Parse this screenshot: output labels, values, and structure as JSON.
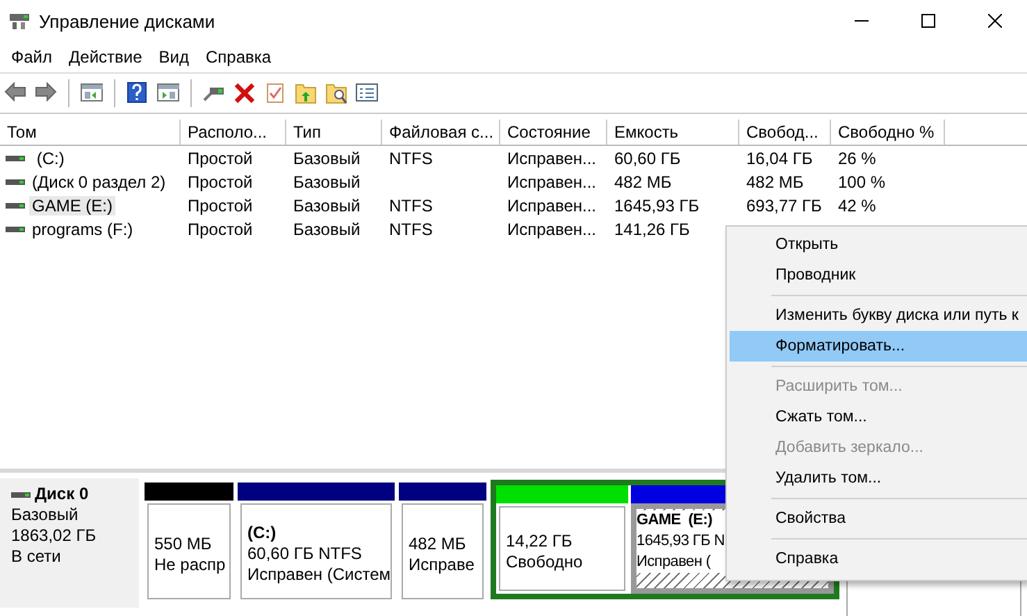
{
  "window": {
    "title": "Управление дисками"
  },
  "menu_bar": [
    "Файл",
    "Действие",
    "Вид",
    "Справка"
  ],
  "toolbar": [
    {
      "kind": "back"
    },
    {
      "kind": "forward"
    },
    {
      "kind": "separator"
    },
    {
      "kind": "tree"
    },
    {
      "kind": "separator"
    },
    {
      "kind": "help"
    },
    {
      "kind": "pane"
    },
    {
      "kind": "separator"
    },
    {
      "kind": "connect"
    },
    {
      "kind": "delete"
    },
    {
      "kind": "properties"
    },
    {
      "kind": "folder-up"
    },
    {
      "kind": "folder-search"
    },
    {
      "kind": "list"
    }
  ],
  "table": {
    "columns": [
      "Том",
      "Располо...",
      "Тип",
      "Файловая с...",
      "Состояние",
      "Емкость",
      "Свобод...",
      "Свободно %"
    ],
    "rows": [
      {
        "selected": false,
        "cells": [
          " (C:)",
          "Простой",
          "Базовый",
          "NTFS",
          "Исправен...",
          "60,60 ГБ",
          "16,04 ГБ",
          "26 %"
        ]
      },
      {
        "selected": false,
        "cells": [
          "(Диск 0 раздел 2)",
          "Простой",
          "Базовый",
          "",
          "Исправен...",
          "482 МБ",
          "482 МБ",
          "100 %"
        ]
      },
      {
        "selected": true,
        "cells": [
          "GAME (E:)",
          "Простой",
          "Базовый",
          "NTFS",
          "Исправен...",
          "1645,93 ГБ",
          "693,77 ГБ",
          "42 %"
        ]
      },
      {
        "selected": false,
        "cells": [
          "programs (F:)",
          "Простой",
          "Базовый",
          "NTFS",
          "Исправен...",
          "141,26 ГБ",
          "",
          ""
        ]
      }
    ]
  },
  "disk": {
    "name": "Диск 0",
    "type": "Базовый",
    "size": "1863,02 ГБ",
    "status": "В сети",
    "partitions": [
      {
        "kind": "unallocated",
        "selected": false,
        "lines": [
          "550 МБ",
          "Не распр"
        ]
      },
      {
        "kind": "primary",
        "selected": false,
        "title": "(C:)",
        "lines": [
          "60,60 ГБ NTFS",
          "Исправен (Систем"
        ]
      },
      {
        "kind": "primary",
        "selected": false,
        "lines": [
          "482 МБ",
          "Исправе"
        ]
      },
      {
        "kind": "extended",
        "children": [
          {
            "kind": "free",
            "selected": false,
            "lines": [
              "14,22 ГБ",
              "Свободно"
            ]
          },
          {
            "kind": "logical",
            "selected": true,
            "title": "GAME  (E:)",
            "lines": [
              "1645,93 ГБ N",
              "Исправен ("
            ]
          }
        ]
      },
      {
        "kind": "primary",
        "selected": false
      }
    ]
  },
  "context_menu": [
    {
      "kind": "item",
      "label": "Открыть",
      "disabled": false,
      "selected": false
    },
    {
      "kind": "item",
      "label": "Проводник",
      "disabled": false,
      "selected": false
    },
    {
      "kind": "separator"
    },
    {
      "kind": "item",
      "label": "Изменить букву диска или путь к",
      "disabled": false,
      "selected": false
    },
    {
      "kind": "item",
      "label": "Форматировать...",
      "disabled": false,
      "selected": true
    },
    {
      "kind": "separator"
    },
    {
      "kind": "item",
      "label": "Расширить том...",
      "disabled": true,
      "selected": false
    },
    {
      "kind": "item",
      "label": "Сжать том...",
      "disabled": false,
      "selected": false
    },
    {
      "kind": "item",
      "label": "Добавить зеркало...",
      "disabled": true,
      "selected": false
    },
    {
      "kind": "item",
      "label": "Удалить том...",
      "disabled": false,
      "selected": false
    },
    {
      "kind": "separator"
    },
    {
      "kind": "item",
      "label": "Свойства",
      "disabled": false,
      "selected": false
    },
    {
      "kind": "separator"
    },
    {
      "kind": "item",
      "label": "Справка",
      "disabled": false,
      "selected": false
    }
  ]
}
